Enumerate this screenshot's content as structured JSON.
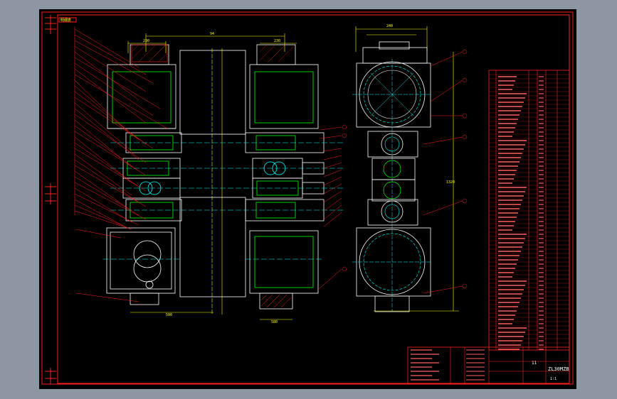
{
  "drawing": {
    "title_block_name": "ZL30MZB",
    "title_block_sheet": "11",
    "title_block_scale": "1:1",
    "parts_list_header": "明细表",
    "dimension_labels": [
      "230",
      "94",
      "150",
      "220",
      "240",
      "170",
      "500",
      "580",
      "1320"
    ],
    "callouts": [
      "42",
      "43",
      "44",
      "45",
      "46",
      "47"
    ],
    "colors": {
      "background": "#000000",
      "frame": "#ff0000",
      "outline": "#ffffff",
      "centerline": "#00ffff",
      "gear": "#00ff00",
      "dimension": "#ffff00",
      "leader": "#ff2020"
    }
  }
}
